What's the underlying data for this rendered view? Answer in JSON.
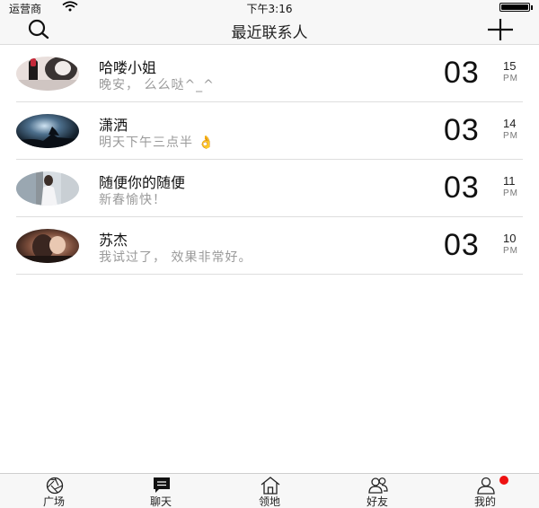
{
  "status_bar": {
    "carrier": "运营商",
    "time": "下午3:16"
  },
  "nav": {
    "title": "最近联系人",
    "left_icon": "search-icon",
    "right_icon": "plus-icon"
  },
  "contacts": [
    {
      "name": "哈喽小姐",
      "message": "晚安，  么么哒^_^",
      "day": "03",
      "hour": "15",
      "ampm": "PM",
      "avatar": "avatar-pink-lipstick"
    },
    {
      "name": "潇洒",
      "message": "明天下午三点半 👌",
      "day": "03",
      "hour": "14",
      "ampm": "PM",
      "avatar": "avatar-wolf-moon"
    },
    {
      "name": "随便你的随便",
      "message": "新春愉快！",
      "day": "03",
      "hour": "11",
      "ampm": "PM",
      "avatar": "avatar-girl-white"
    },
    {
      "name": "苏杰",
      "message": "我试过了， 效果非常好。",
      "day": "03",
      "hour": "10",
      "ampm": "PM",
      "avatar": "avatar-warm-portrait"
    }
  ],
  "tabs": [
    {
      "label": "广场",
      "icon": "aperture-icon"
    },
    {
      "label": "聊天",
      "icon": "chat-icon"
    },
    {
      "label": "领地",
      "icon": "house-icon"
    },
    {
      "label": "好友",
      "icon": "friends-icon"
    },
    {
      "label": "我的",
      "icon": "profile-icon",
      "badge": true
    }
  ],
  "colors": {
    "badge": "#ee1111",
    "secondary_text": "#9a9a9a",
    "bar_background": "#f7f7f7"
  }
}
